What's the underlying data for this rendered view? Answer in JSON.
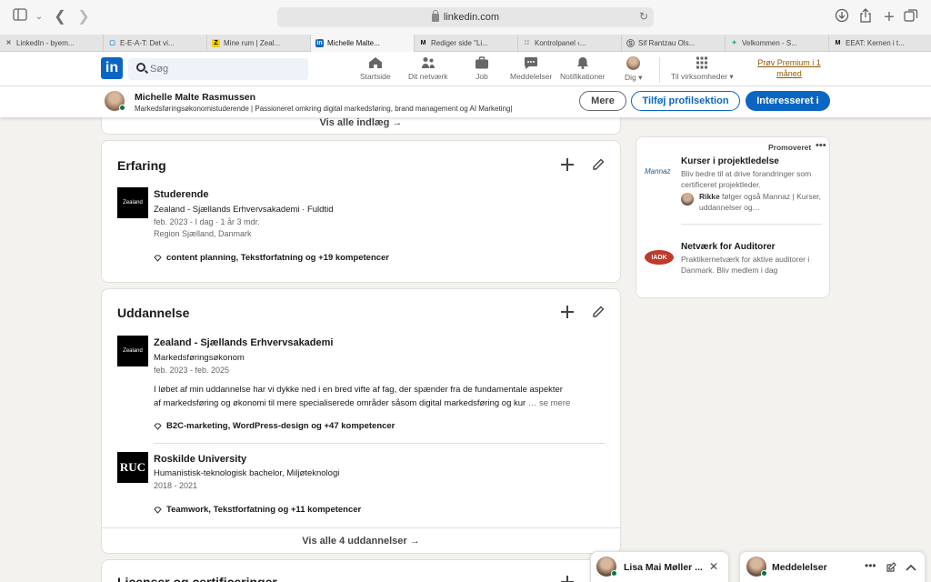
{
  "browser": {
    "url": "linkedin.com",
    "tabs": [
      {
        "label": "LinkedIn - byem...",
        "icon": "pin-icon",
        "active": false
      },
      {
        "label": "E-E-A-T: Det vi...",
        "icon": "site-icon",
        "active": false
      },
      {
        "label": "Mine rum | Zeal...",
        "icon": "zealand-icon",
        "active": false
      },
      {
        "label": "Michelle Malte...",
        "icon": "linkedin-icon",
        "active": true
      },
      {
        "label": "Rediger side \"Li...",
        "icon": "m-icon",
        "active": false
      },
      {
        "label": "Kontrolpanel ‹...",
        "icon": "wordpress-icon",
        "active": false
      },
      {
        "label": "Sif Rantzau Ols...",
        "icon": "s-icon",
        "active": false
      },
      {
        "label": "Velkommen - S...",
        "icon": "leaf-icon",
        "active": false
      },
      {
        "label": "EEAT: Kernen i t...",
        "icon": "m-icon",
        "active": false
      }
    ]
  },
  "nav": {
    "search_placeholder": "Søg",
    "items": [
      {
        "label": "Startside",
        "icon": "home-icon"
      },
      {
        "label": "Dit netværk",
        "icon": "network-icon"
      },
      {
        "label": "Job",
        "icon": "briefcase-icon"
      },
      {
        "label": "Meddelelser",
        "icon": "chat-icon"
      },
      {
        "label": "Notifikationer",
        "icon": "bell-icon"
      },
      {
        "label": "Dig ▾",
        "icon": "avatar"
      },
      {
        "label": "Til virksomheder ▾",
        "icon": "grid-icon"
      }
    ],
    "premium_line1": "Prøv Premium i 1",
    "premium_line2": "måned"
  },
  "profile_bar": {
    "name": "Michelle Malte Rasmussen",
    "headline": "Markedsføringsøkonomistuderende | Passioneret omkring digital markedsføring, brand management og AI Marketing|",
    "more_label": "Mere",
    "add_section_label": "Tilføj profilsektion",
    "interested_label": "Interesseret i"
  },
  "posts": {
    "show_all": "Vis alle indlæg →"
  },
  "experience": {
    "title": "Erfaring",
    "entries": [
      {
        "logo": "Zealand",
        "title": "Studerende",
        "org": "Zealand - Sjællands Erhvervsakademi · Fuldtid",
        "dates": "feb. 2023 - I dag · 1 år 3 mdr.",
        "location": "Region Sjælland, Danmark",
        "skills": "content planning, Tekstforfatning og +19 kompetencer"
      }
    ]
  },
  "education": {
    "title": "Uddannelse",
    "entries": [
      {
        "logo": "Zealand",
        "title": "Zealand - Sjællands Erhvervsakademi",
        "degree": "Markedsføringsøkonom",
        "dates": "feb. 2023 - feb. 2025",
        "desc_line1": "I løbet af min uddannelse har vi dykke ned i en bred vifte af fag, der spænder fra de fundamentale aspekter",
        "desc_line2": "af markedsføring og økonomi til mere specialiserede områder såsom digital markedsføring og kur",
        "see_more": "… se mere",
        "skills": "B2C-marketing, WordPress-design og +47 kompetencer"
      },
      {
        "logo": "RUC",
        "title": "Roskilde University",
        "degree": "Humanistisk-teknologisk bachelor, Miljøteknologi",
        "dates": "2018 - 2021",
        "skills": "Teamwork, Tekstforfatning og +11 kompetencer"
      }
    ],
    "show_all": "Vis alle 4 uddannelser →"
  },
  "licenses": {
    "title": "Licenser og certificeringer"
  },
  "promoted": {
    "label": "Promoveret",
    "items": [
      {
        "logo": "Mannaz",
        "title": "Kurser i projektledelse",
        "text": "Bliv bedre til at drive forandringer som certificeret projektleder.",
        "social_name": "Rikke",
        "social_text": " følger også Mannaz | Kurser, uddannelser og…"
      },
      {
        "logo": "IADK",
        "title": "Netværk for Auditorer",
        "text": "Praktikernetværk for aktive auditorer i Danmark. Bliv medlem i dag"
      }
    ]
  },
  "messaging": {
    "chat_name": "Lisa Mai Møller ...",
    "panel_title": "Meddelelser"
  },
  "colors": {
    "brand": "#0a66c2",
    "online": "#057642",
    "premium": "#915907"
  }
}
